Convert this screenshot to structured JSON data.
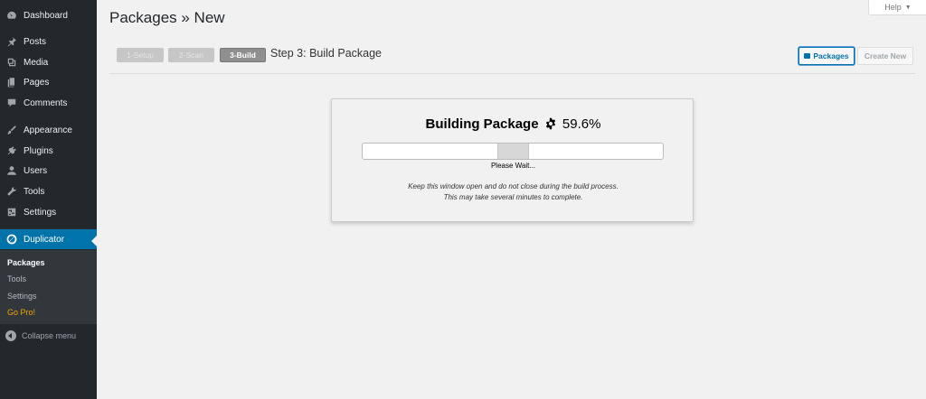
{
  "sidebar": {
    "items": [
      {
        "label": "Dashboard",
        "icon": "dashboard-icon"
      },
      {
        "label": "Posts",
        "icon": "pin-icon"
      },
      {
        "label": "Media",
        "icon": "media-icon"
      },
      {
        "label": "Pages",
        "icon": "pages-icon"
      },
      {
        "label": "Comments",
        "icon": "comment-icon"
      },
      {
        "label": "Appearance",
        "icon": "brush-icon"
      },
      {
        "label": "Plugins",
        "icon": "plug-icon"
      },
      {
        "label": "Users",
        "icon": "user-icon"
      },
      {
        "label": "Tools",
        "icon": "wrench-icon"
      },
      {
        "label": "Settings",
        "icon": "settings-icon"
      },
      {
        "label": "Duplicator",
        "icon": "duplicator-icon"
      }
    ],
    "submenu": [
      "Packages",
      "Tools",
      "Settings",
      "Go Pro!"
    ],
    "collapse": "Collapse menu"
  },
  "help": "Help",
  "page": {
    "title": "Packages » New",
    "steps": [
      "1-Setup",
      "2-Scan",
      "3-Build"
    ],
    "step_title": "Step 3: Build Package",
    "packages_btn": "Packages",
    "create_new_btn": "Create New"
  },
  "build": {
    "heading": "Building Package",
    "percent": "59.6%",
    "wait": "Please Wait...",
    "note1": "Keep this window open and do not close during the build process.",
    "note2": "This may take several minutes to complete.",
    "progress_fraction": 0.45
  },
  "colors": {
    "sidebar_bg": "#23282d",
    "accent": "#0073aa",
    "gopro": "#f0a500"
  }
}
